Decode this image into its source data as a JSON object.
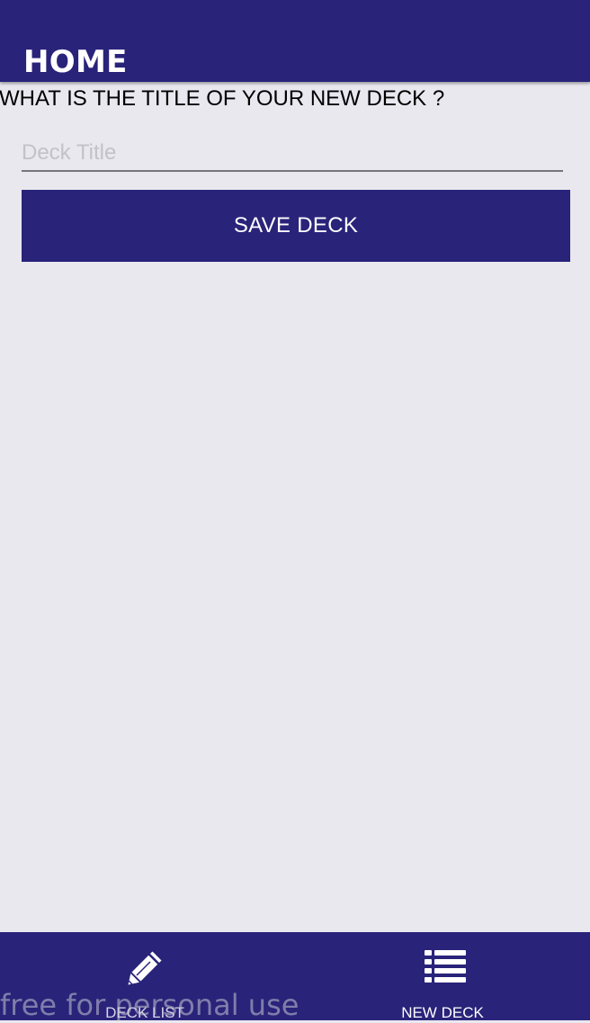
{
  "header": {
    "title": "HOME"
  },
  "form": {
    "question": "WHAT IS THE TITLE OF YOUR NEW DECK ?",
    "title_input": {
      "placeholder": "Deck Title",
      "value": ""
    },
    "save_label": "SAVE DECK"
  },
  "bottom_nav": {
    "tabs": [
      {
        "label": "DECK LIST",
        "icon": "pencil-icon",
        "active": false
      },
      {
        "label": "NEW DECK",
        "icon": "list-icon",
        "active": true
      }
    ]
  },
  "watermark": "free for personal use",
  "colors": {
    "primary": "#29237a",
    "background": "#e9e8ef",
    "inactive_tab_label": "#d7d5e6",
    "active_tab_label": "#ffffff"
  }
}
